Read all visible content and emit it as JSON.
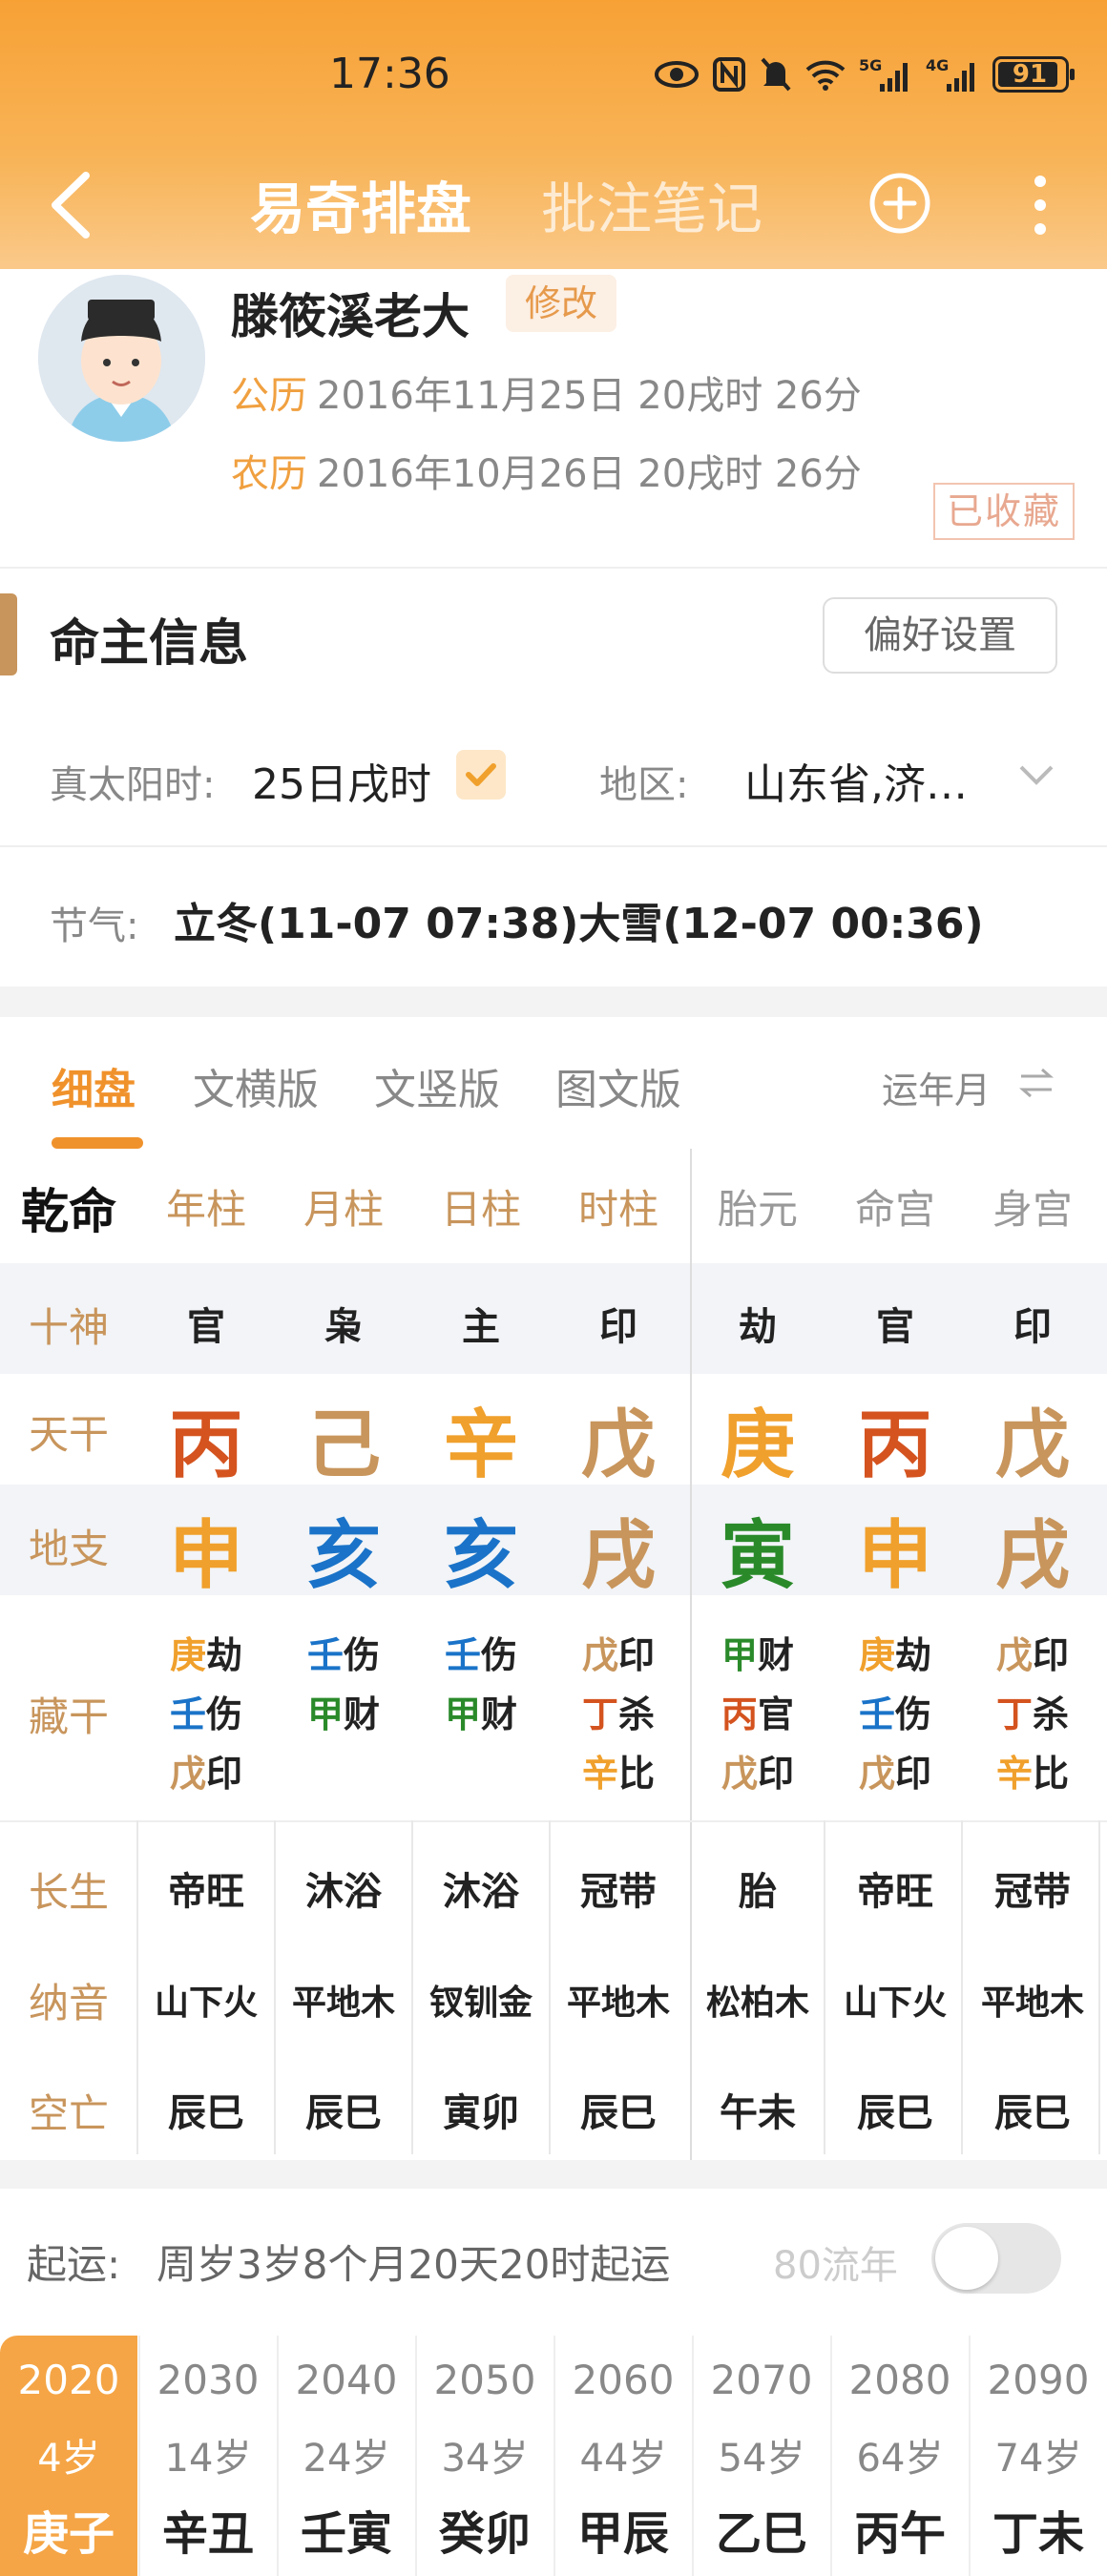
{
  "status": {
    "time": "17:36",
    "battery": "91"
  },
  "nav": {
    "tab_active": "易奇排盘",
    "tab_inactive": "批注笔记"
  },
  "profile": {
    "name": "滕筱溪老大",
    "edit_label": "修改",
    "solar_label": "公历",
    "solar_date": "2016年11月25日 20戌时 26分",
    "lunar_label": "农历",
    "lunar_date": "2016年10月26日 20戌时 26分",
    "stamp": "已收藏"
  },
  "info": {
    "title": "命主信息",
    "pref_button": "偏好设置",
    "true_solar_label": "真太阳时:",
    "true_solar_value": "25日戌时",
    "region_label": "地区:",
    "region_value": "山东省,济…",
    "jieqi_label": "节气:",
    "jieqi_value": "立冬(11-07 07:38)大雪(12-07 00:36)"
  },
  "tabs": {
    "t1": "细盘",
    "t2": "文横版",
    "t3": "文竖版",
    "t4": "图文版",
    "right": "运年月",
    "right_icon": "swap-icon"
  },
  "chart": {
    "qianming": "乾命",
    "headers": [
      "年柱",
      "月柱",
      "日柱",
      "时柱",
      "胎元",
      "命宫",
      "身宫"
    ],
    "row_labels": {
      "shishen": "十神",
      "tiangan": "天干",
      "dizhi": "地支",
      "canggan": "藏干",
      "changsheng": "长生",
      "nayin": "纳音",
      "kongwang": "空亡"
    },
    "shishen": [
      "官",
      "枭",
      "主",
      "印",
      "劫",
      "官",
      "印"
    ],
    "tiangan": [
      "丙",
      "己",
      "辛",
      "戊",
      "庚",
      "丙",
      "戊"
    ],
    "tiangan_colors": [
      "#d4531f",
      "#c8955c",
      "#f0a02c",
      "#c8955c",
      "#f0a02c",
      "#d4531f",
      "#c8955c"
    ],
    "dizhi": [
      "申",
      "亥",
      "亥",
      "戌",
      "寅",
      "申",
      "戌"
    ],
    "dizhi_colors": [
      "#f0a02c",
      "#1a73c8",
      "#1a73c8",
      "#c8955c",
      "#2a8a2a",
      "#f0a02c",
      "#c8955c"
    ],
    "canggan": [
      [
        [
          "庚",
          "劫",
          "#f0a02c"
        ],
        [
          "壬",
          "伤",
          "#1a73c8"
        ],
        [
          "戊",
          "印",
          "#c8955c"
        ]
      ],
      [
        [
          "壬",
          "伤",
          "#1a73c8"
        ],
        [
          "甲",
          "财",
          "#2a8a2a"
        ]
      ],
      [
        [
          "壬",
          "伤",
          "#1a73c8"
        ],
        [
          "甲",
          "财",
          "#2a8a2a"
        ]
      ],
      [
        [
          "戊",
          "印",
          "#c8955c"
        ],
        [
          "丁",
          "杀",
          "#d4531f"
        ],
        [
          "辛",
          "比",
          "#f0a02c"
        ]
      ],
      [
        [
          "甲",
          "财",
          "#2a8a2a"
        ],
        [
          "丙",
          "官",
          "#d4531f"
        ],
        [
          "戊",
          "印",
          "#c8955c"
        ]
      ],
      [
        [
          "庚",
          "劫",
          "#f0a02c"
        ],
        [
          "壬",
          "伤",
          "#1a73c8"
        ],
        [
          "戊",
          "印",
          "#c8955c"
        ]
      ],
      [
        [
          "戊",
          "印",
          "#c8955c"
        ],
        [
          "丁",
          "杀",
          "#d4531f"
        ],
        [
          "辛",
          "比",
          "#f0a02c"
        ]
      ]
    ],
    "changsheng": [
      "帝旺",
      "沐浴",
      "沐浴",
      "冠带",
      "胎",
      "帝旺",
      "冠带"
    ],
    "nayin": [
      "山下火",
      "平地木",
      "钗钏金",
      "平地木",
      "松柏木",
      "山下火",
      "平地木"
    ],
    "kongwang": [
      "辰巳",
      "辰巳",
      "寅卯",
      "辰巳",
      "午未",
      "辰巳",
      "辰巳"
    ]
  },
  "qiyun": {
    "label": "起运:",
    "text": "周岁3岁8个月20天20时起运",
    "toggle_label": "80流年"
  },
  "dayun": [
    {
      "year": "2020",
      "age": "4岁",
      "gz": "庚子"
    },
    {
      "year": "2030",
      "age": "14岁",
      "gz": "辛丑"
    },
    {
      "year": "2040",
      "age": "24岁",
      "gz": "壬寅"
    },
    {
      "year": "2050",
      "age": "34岁",
      "gz": "癸卯"
    },
    {
      "year": "2060",
      "age": "44岁",
      "gz": "甲辰"
    },
    {
      "year": "2070",
      "age": "54岁",
      "gz": "乙巳"
    },
    {
      "year": "2080",
      "age": "64岁",
      "gz": "丙午"
    },
    {
      "year": "2090",
      "age": "74岁",
      "gz": "丁未"
    }
  ],
  "colors": {
    "accent": "#f0922c",
    "brown": "#c8955c"
  }
}
